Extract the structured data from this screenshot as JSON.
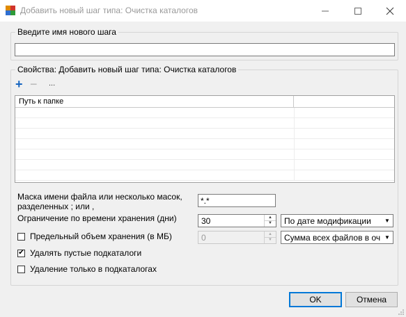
{
  "window": {
    "title": "Добавить новый шаг типа: Очистка каталогов",
    "controls": [
      "minimize",
      "maximize",
      "close"
    ]
  },
  "name_group": {
    "legend": "Введите имя нового шага",
    "name_value": ""
  },
  "props_group": {
    "legend": "Свойства: Добавить новый шаг типа: Очистка каталогов",
    "toolbar": {
      "add": "+",
      "remove": "−",
      "more": "..."
    },
    "grid": {
      "columns": [
        "Путь к папке",
        ""
      ],
      "rows": []
    },
    "mask": {
      "label_line1": "Маска имени файла или несколько масок,",
      "label_line2": "разделенных ; или ,",
      "value": "*.*"
    },
    "retention": {
      "label": "Ограничение по времени хранения (дни)",
      "value": "30",
      "mode_selected": "По дате модификации"
    },
    "size_limit": {
      "label": "Предельный объем хранения (в МБ)",
      "checked": false,
      "value": "0",
      "mode_selected": "Сумма всех файлов в очищ"
    },
    "delete_empty": {
      "label": "Удалять пустые подкаталоги",
      "checked": true
    },
    "delete_sub_only": {
      "label": "Удаление только в подкаталогах",
      "checked": false
    }
  },
  "buttons": {
    "ok": "OK",
    "cancel": "Отмена"
  },
  "colors": {
    "accent": "#0078d7",
    "add_icon": "#1565c0"
  }
}
